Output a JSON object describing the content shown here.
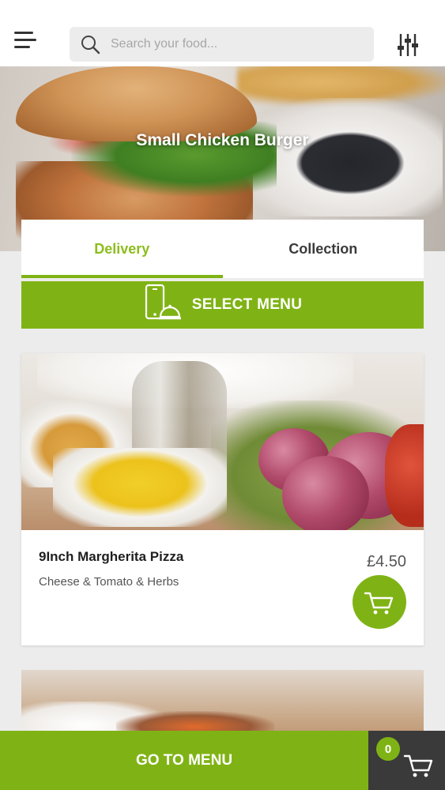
{
  "header": {
    "search_placeholder": "Search your food..."
  },
  "hero": {
    "title": "Small Chicken Burger"
  },
  "tabs": [
    {
      "label": "Delivery",
      "active": true
    },
    {
      "label": "Collection",
      "active": false
    }
  ],
  "select_menu": {
    "label": "SELECT MENU",
    "icon": "phone-food-icon"
  },
  "menu_items": [
    {
      "name": "9Inch Margherita Pizza",
      "description": "Cheese & Tomato & Herbs",
      "price": "£4.50",
      "cart_icon": "cart-icon"
    }
  ],
  "bottom_bar": {
    "goto_label": "GO TO MENU",
    "cart_count": "0",
    "cart_icon": "cart-icon"
  },
  "colors": {
    "accent": "#7fb315",
    "accent_text": "#8dbd1e",
    "dark": "#3a3a3a",
    "background": "#ececec"
  }
}
